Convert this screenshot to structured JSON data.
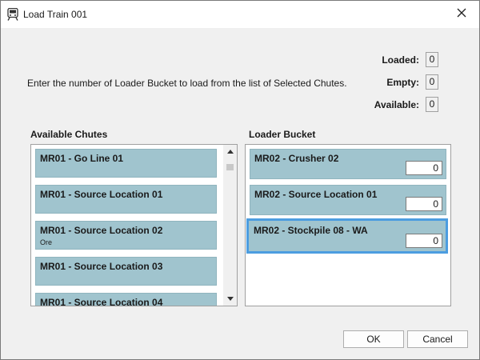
{
  "window": {
    "title": "Load Train 001"
  },
  "stats": [
    {
      "label": "Loaded:",
      "value": "0"
    },
    {
      "label": "Empty:",
      "value": "0"
    },
    {
      "label": "Available:",
      "value": "0"
    }
  ],
  "instruction": "Enter the number of Loader Bucket to load from the list of Selected Chutes.",
  "available_chutes": {
    "label": "Available Chutes",
    "items": [
      {
        "title": "MR01 - Go Line 01",
        "sub": ""
      },
      {
        "title": "MR01 - Source Location 01",
        "sub": ""
      },
      {
        "title": "MR01 - Source Location 02",
        "sub": "Ore"
      },
      {
        "title": "MR01 - Source Location 03",
        "sub": ""
      },
      {
        "title": "MR01 - Source Location 04",
        "sub": ""
      }
    ]
  },
  "loader_bucket": {
    "label": "Loader Bucket",
    "items": [
      {
        "title": "MR02 - Crusher 02",
        "qty": "0"
      },
      {
        "title": "MR02 - Source Location 01",
        "qty": "0"
      },
      {
        "title": "MR02 - Stockpile 08 - WA",
        "qty": "0"
      }
    ]
  },
  "buttons": {
    "ok": "OK",
    "cancel": "Cancel"
  },
  "colors": {
    "item_bg": "#a0c4ce",
    "selected_border": "#4c9de0",
    "window_bg": "#f0f0f0"
  }
}
